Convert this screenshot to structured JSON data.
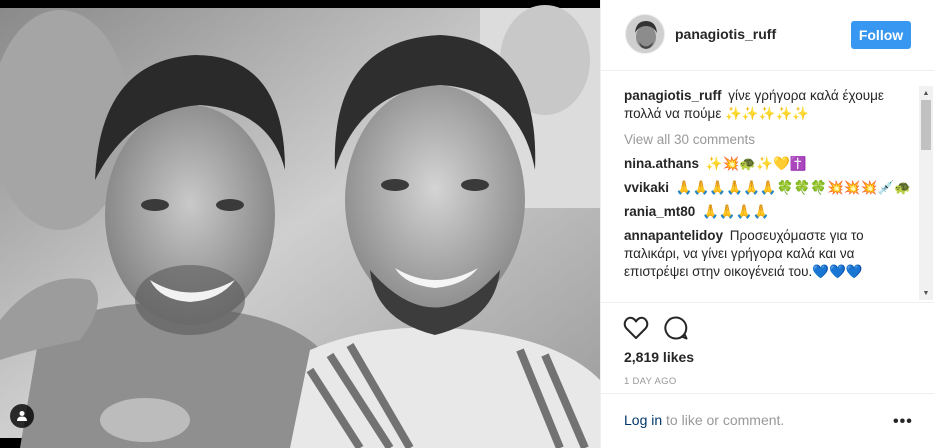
{
  "post": {
    "username": "panagiotis_ruff",
    "follow_label": "Follow"
  },
  "comments": [
    {
      "user": "panagiotis_ruff",
      "text": "γίνε γρήγορα καλά έχουμε πολλά να πούμε ✨✨✨✨✨"
    }
  ],
  "view_all_label": "View all 30 comments",
  "comment_list": [
    {
      "user": "nina.athans",
      "text": "✨💥🐢✨💛✝️"
    },
    {
      "user": "vvikaki",
      "text": "🙏🙏🙏🙏🙏🙏🍀🍀🍀💥💥💥💉🐢"
    },
    {
      "user": "rania_mt80",
      "text": "🙏🙏🙏🙏"
    },
    {
      "user": "annapantelidoy",
      "text": "Προσευχόμαστε για το παλικάρι, να γίνει γρήγορα καλά και να επιστρέψει στην οικογένειά του.💙💙💙"
    }
  ],
  "likes_label": "2,819 likes",
  "date_label": "1 DAY AGO",
  "footer": {
    "login_link": "Log in",
    "login_rest": " to like or comment.",
    "more": "•••"
  },
  "icons": {
    "like": "heart-icon",
    "comment": "comment-bubble-icon",
    "tag": "user-tag-icon",
    "more": "more-dots-icon"
  },
  "colors": {
    "follow_bg": "#3897f0",
    "link": "#003569",
    "muted": "#999999"
  }
}
